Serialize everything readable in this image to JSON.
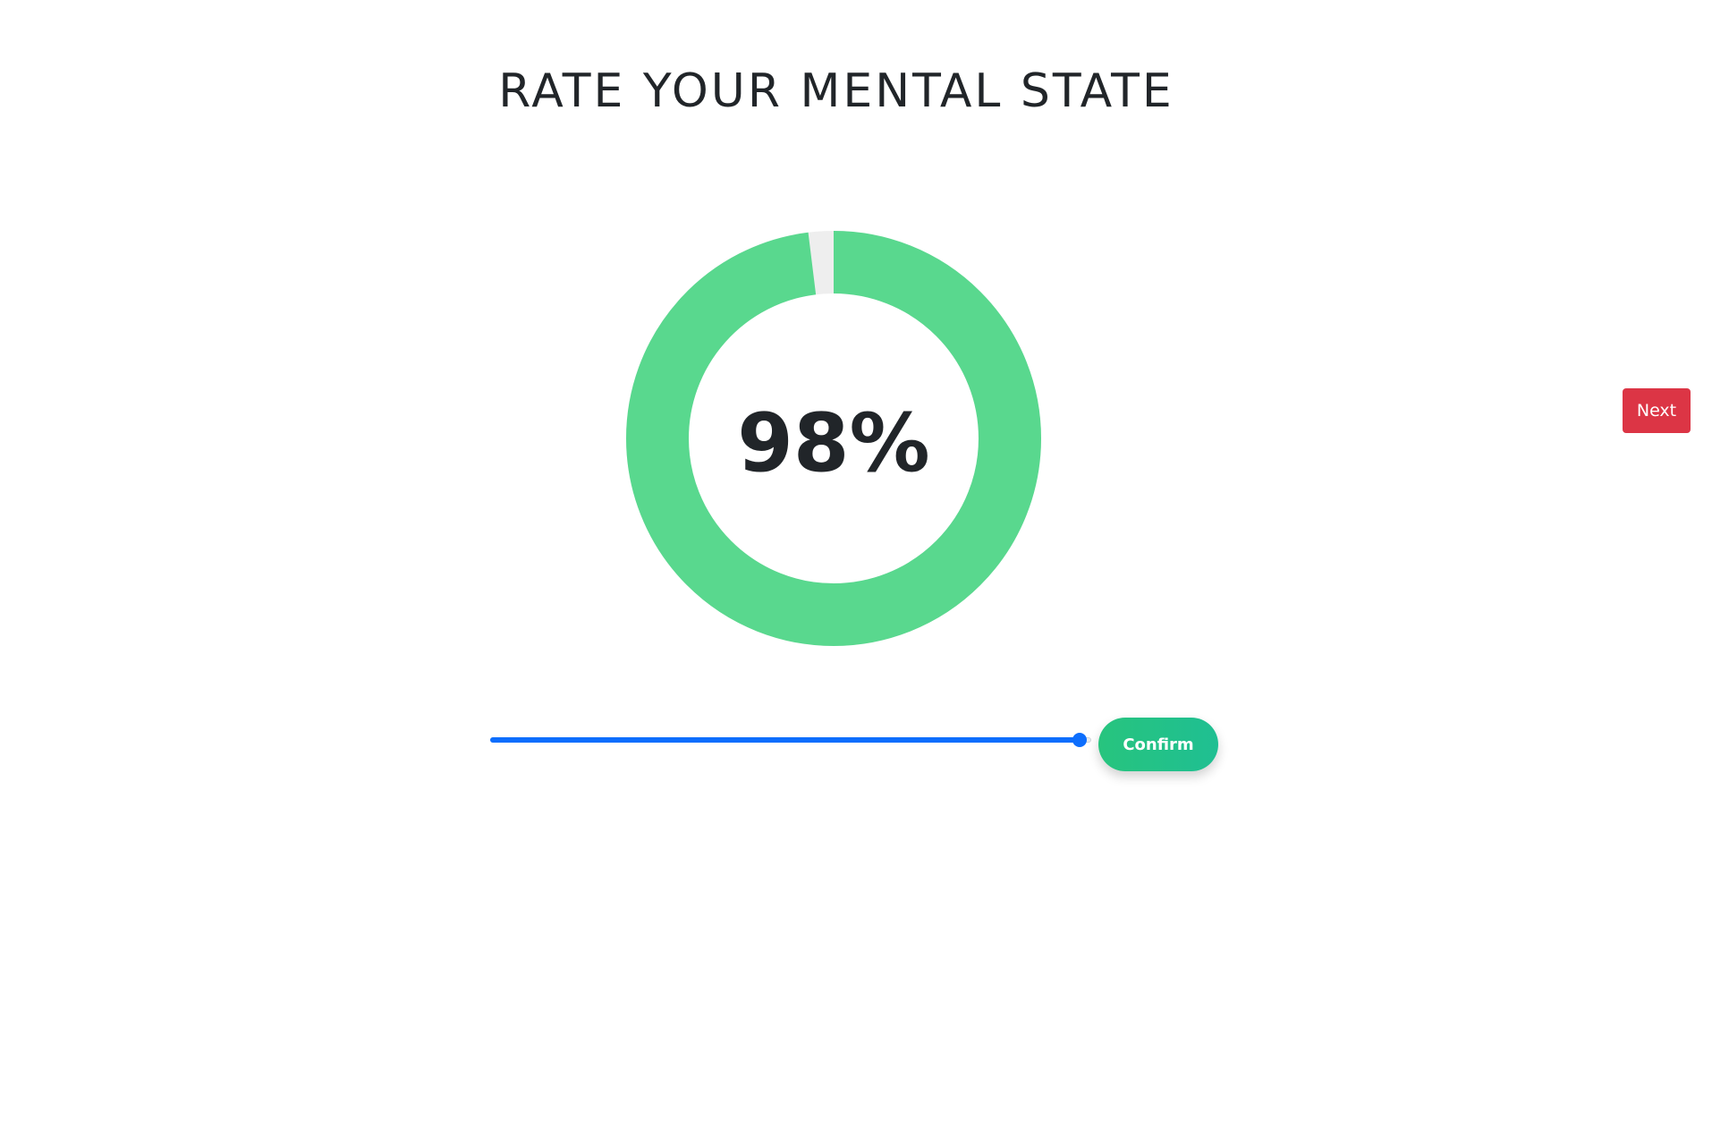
{
  "page": {
    "title": "RATE YOUR MENTAL STATE"
  },
  "gauge": {
    "value": 98,
    "label": "98%",
    "fill_color": "#59d88e",
    "remainder_color": "#eeeeee"
  },
  "slider": {
    "value": 98,
    "min": 0,
    "max": 100,
    "color": "#0d6efd"
  },
  "buttons": {
    "confirm_label": "Confirm",
    "next_label": "Next"
  },
  "colors": {
    "confirm": "#1fbf8a",
    "next": "#dc3545",
    "text": "#212529"
  }
}
